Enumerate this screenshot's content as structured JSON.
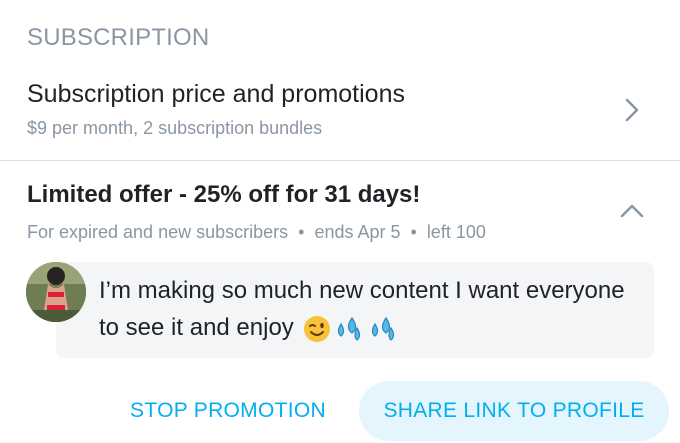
{
  "section": {
    "header": "SUBSCRIPTION"
  },
  "price": {
    "title": "Subscription price and promotions",
    "subtitle": "$9 per month, 2 subscription bundles",
    "icon": "chevron-right-icon"
  },
  "offer": {
    "title": "Limited offer - 25% off for 31 days!",
    "audience": "For expired and new subscribers",
    "ends": "ends Apr 5",
    "left": "left 100",
    "separator": "•",
    "icon": "chevron-up-icon",
    "message": "I’m making so much new content I want everyone to see it and enjoy",
    "emojis": [
      "winking-face",
      "sweat-droplets",
      "sweat-droplets"
    ]
  },
  "actions": {
    "stop_label": "STOP PROMOTION",
    "share_label": "SHARE LINK TO PROFILE"
  },
  "colors": {
    "accent": "#00aff0",
    "muted": "#8a96a3",
    "bubble": "#f4f5f7",
    "share_bg": "#e5f5fd"
  }
}
